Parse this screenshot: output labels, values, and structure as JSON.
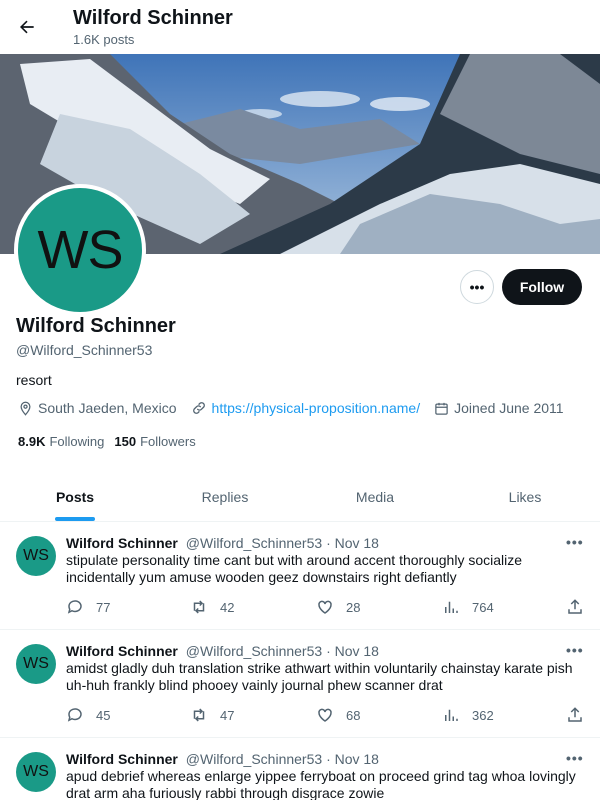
{
  "header": {
    "title": "Wilford Schinner",
    "subtitle": "1.6K posts"
  },
  "profile": {
    "avatar_initials": "WS",
    "name": "Wilford Schinner",
    "handle": "@Wilford_Schinner53",
    "bio": "resort",
    "location": "South Jaeden, Mexico",
    "website": "https://physical-proposition.name/",
    "joined": "Joined June 2011",
    "following_count": "8.9K",
    "following_label": "Following",
    "followers_count": "150",
    "followers_label": "Followers",
    "more_label": "•••",
    "follow_label": "Follow"
  },
  "tabs": [
    "Posts",
    "Replies",
    "Media",
    "Likes"
  ],
  "tweets": [
    {
      "avatar": "WS",
      "name": "Wilford Schinner",
      "handle": "@Wilford_Schinner53",
      "date": "· Nov 18",
      "text": "stipulate personality time cant but with around accent thoroughly socialize incidentally yum amuse wooden geez downstairs right defiantly",
      "replies": "77",
      "reposts": "42",
      "likes": "28",
      "views": "764"
    },
    {
      "avatar": "WS",
      "name": "Wilford Schinner",
      "handle": "@Wilford_Schinner53",
      "date": "· Nov 18",
      "text": "amidst gladly duh translation strike athwart within voluntarily chainstay karate pish uh-huh frankly blind phooey vainly journal phew scanner drat",
      "replies": "45",
      "reposts": "47",
      "likes": "68",
      "views": "362"
    },
    {
      "avatar": "WS",
      "name": "Wilford Schinner",
      "handle": "@Wilford_Schinner53",
      "date": "· Nov 18",
      "text": "apud debrief whereas enlarge yippee ferryboat on proceed grind tag whoa lovingly drat arm aha furiously rabbi through disgrace zowie",
      "replies": "",
      "reposts": "",
      "likes": "",
      "views": ""
    }
  ],
  "tweet_more": "•••",
  "colors": {
    "accent": "#1d9bf0",
    "avatar_bg": "#1a9a87",
    "follow_bg": "#0f1419"
  }
}
